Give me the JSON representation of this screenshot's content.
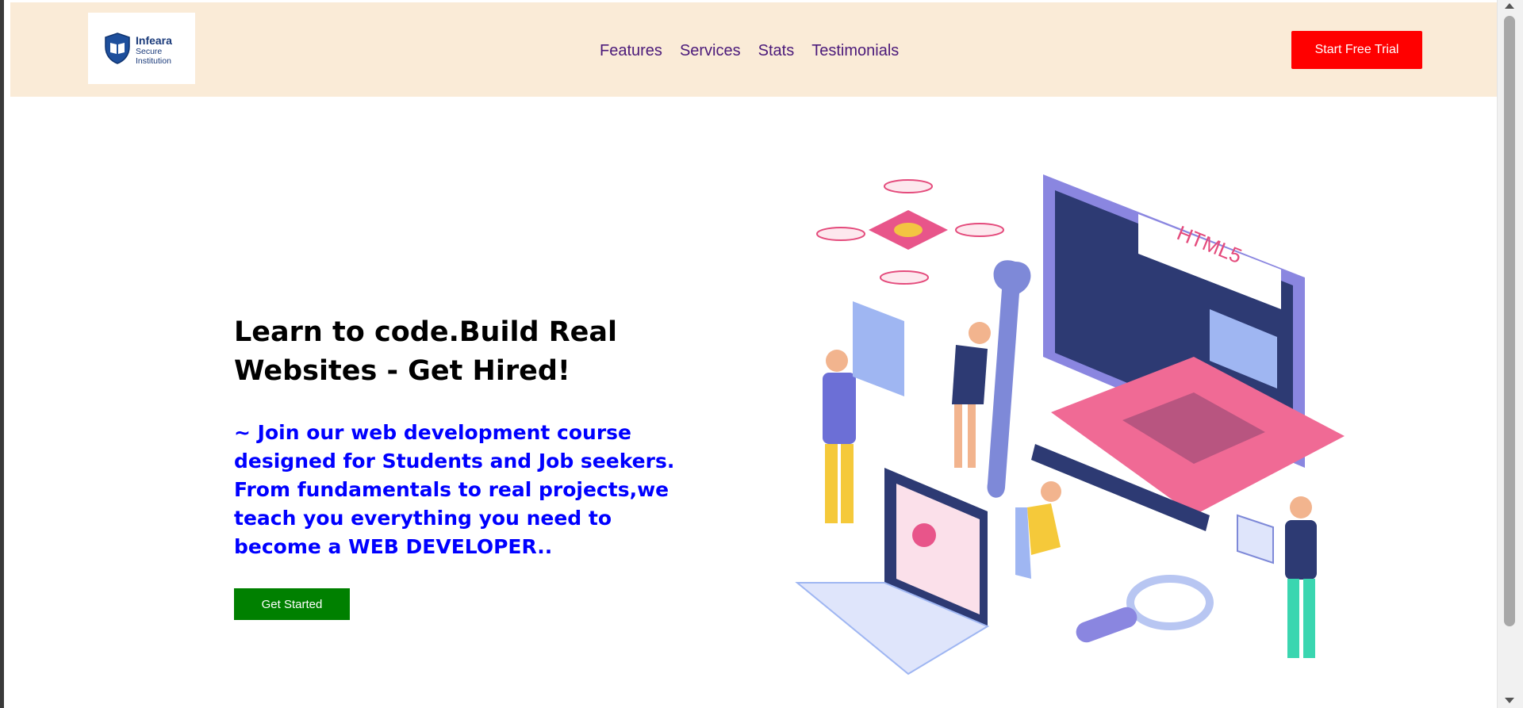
{
  "logo": {
    "name": "Infeara",
    "subtitle": "Secure Institution"
  },
  "nav": {
    "items": [
      "Features",
      "Services",
      "Stats",
      "Testimonials"
    ]
  },
  "header": {
    "cta_label": "Start Free Trial"
  },
  "hero": {
    "title": "Learn to code.Build Real Websites - Get Hired!",
    "description": "~ Join our web development course designed for Students and Job seekers. From fundamentals to real projects,we teach you everything you need to become a WEB DEVELOPER..",
    "button_label": "Get Started",
    "illustration_screen_text": "HTML5"
  },
  "colors": {
    "header_bg": "#faebd7",
    "nav_link": "#4b1a7a",
    "cta_bg": "#ff0000",
    "hero_text": "#0000ff",
    "get_started_bg": "#008000"
  }
}
